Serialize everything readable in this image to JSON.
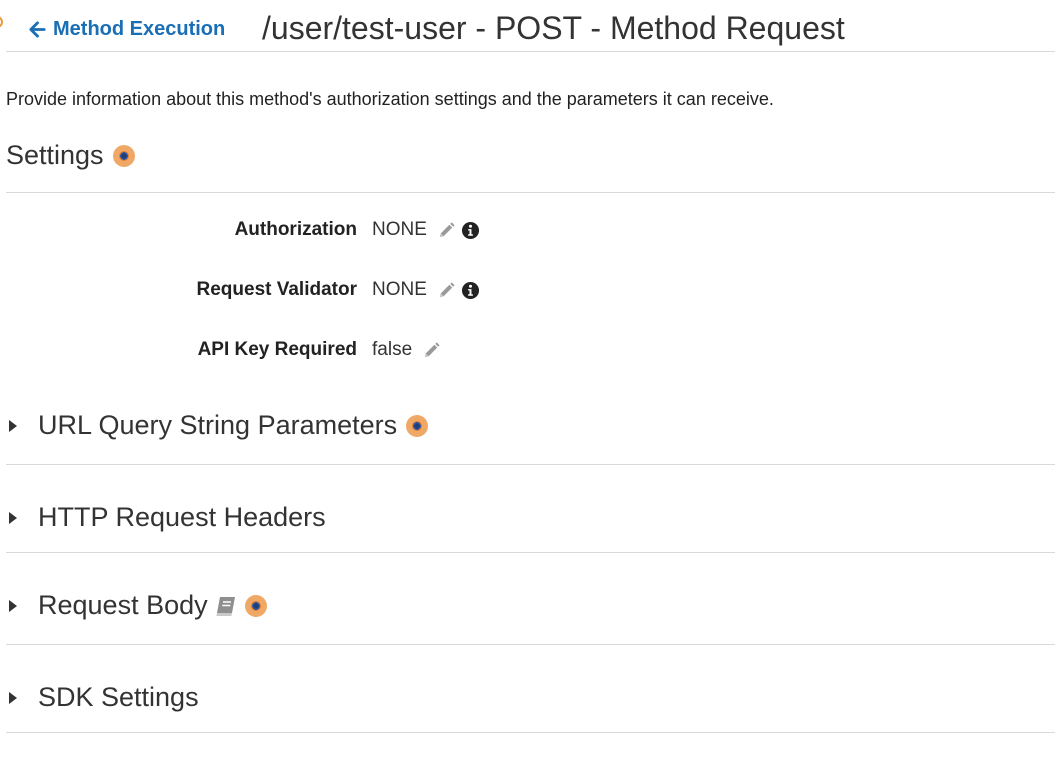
{
  "header": {
    "back_label": "Method Execution",
    "title": "/user/test-user - POST - Method Request"
  },
  "description": "Provide information about this method's authorization settings and the parameters it can receive.",
  "settings": {
    "heading": "Settings",
    "rows": [
      {
        "label": "Authorization",
        "value": "NONE",
        "editable": true,
        "info": true
      },
      {
        "label": "Request Validator",
        "value": "NONE",
        "editable": true,
        "info": true
      },
      {
        "label": "API Key Required",
        "value": "false",
        "editable": true,
        "info": false
      }
    ]
  },
  "sections": [
    {
      "label": "URL Query String Parameters",
      "badge": true,
      "book": false
    },
    {
      "label": "HTTP Request Headers",
      "badge": false,
      "book": false
    },
    {
      "label": "Request Body",
      "badge": true,
      "book": true
    },
    {
      "label": "SDK Settings",
      "badge": false,
      "book": false
    }
  ],
  "colors": {
    "link": "#1a6eb5",
    "badge": "#f0a867",
    "divider": "#d9d9d9",
    "icon_gray": "#999999"
  }
}
